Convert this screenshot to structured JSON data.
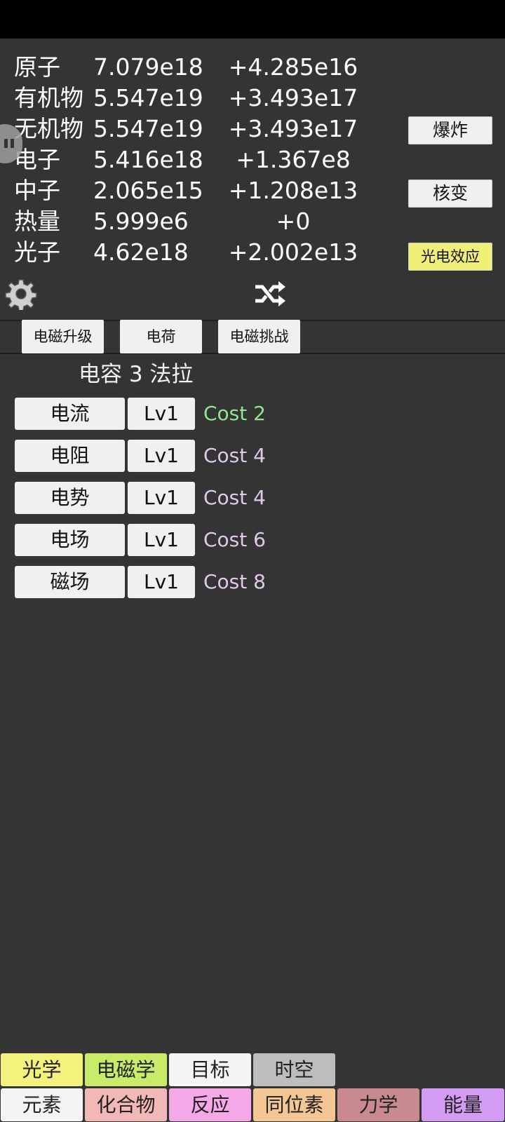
{
  "resources": [
    {
      "name": "原子",
      "value": "7.079e18",
      "rate": "+4.285e16"
    },
    {
      "name": "有机物",
      "value": "5.547e19",
      "rate": "+3.493e17"
    },
    {
      "name": "无机物",
      "value": "5.547e19",
      "rate": "+3.493e17"
    },
    {
      "name": "电子",
      "value": "5.416e18",
      "rate": "+1.367e8"
    },
    {
      "name": "中子",
      "value": "2.065e15",
      "rate": "+1.208e13"
    },
    {
      "name": "热量",
      "value": "5.999e6",
      "rate": "+0"
    },
    {
      "name": "光子",
      "value": "4.62e18",
      "rate": "+2.002e13"
    }
  ],
  "actions": {
    "explode": "爆炸",
    "nuclear": "核变",
    "photoelectric": "光电效应"
  },
  "icons": {
    "settings": "gear-icon",
    "shuffle": "shuffle-icon",
    "pause": "pause-icon"
  },
  "tabs": {
    "upgrade": "电磁升级",
    "charge": "电荷",
    "challenge": "电磁挑战"
  },
  "section_title": "电容 3 法拉",
  "upgrades": [
    {
      "name": "电流",
      "level": "Lv1",
      "cost": "Cost 2",
      "affordable": true
    },
    {
      "name": "电阻",
      "level": "Lv1",
      "cost": "Cost 4",
      "affordable": false
    },
    {
      "name": "电势",
      "level": "Lv1",
      "cost": "Cost 4",
      "affordable": false
    },
    {
      "name": "电场",
      "level": "Lv1",
      "cost": "Cost 6",
      "affordable": false
    },
    {
      "name": "磁场",
      "level": "Lv1",
      "cost": "Cost 8",
      "affordable": false
    }
  ],
  "colors": {
    "affordable": "#8ee68e",
    "unaffordable": "#e0c8e8"
  },
  "nav_row1": [
    {
      "label": "光学",
      "color": "#f2f27c"
    },
    {
      "label": "电磁学",
      "color": "#c8ec6a"
    },
    {
      "label": "目标",
      "color": "#f4f4f4"
    },
    {
      "label": "时空",
      "color": "#bdbdbd"
    }
  ],
  "nav_row2": [
    {
      "label": "元素",
      "color": "#f4f4f4"
    },
    {
      "label": "化合物",
      "color": "#f2b8b8"
    },
    {
      "label": "反应",
      "color": "#f4a8e8"
    },
    {
      "label": "同位素",
      "color": "#f4c694"
    },
    {
      "label": "力学",
      "color": "#c98a8f"
    },
    {
      "label": "能量",
      "color": "#d39cf2"
    }
  ]
}
